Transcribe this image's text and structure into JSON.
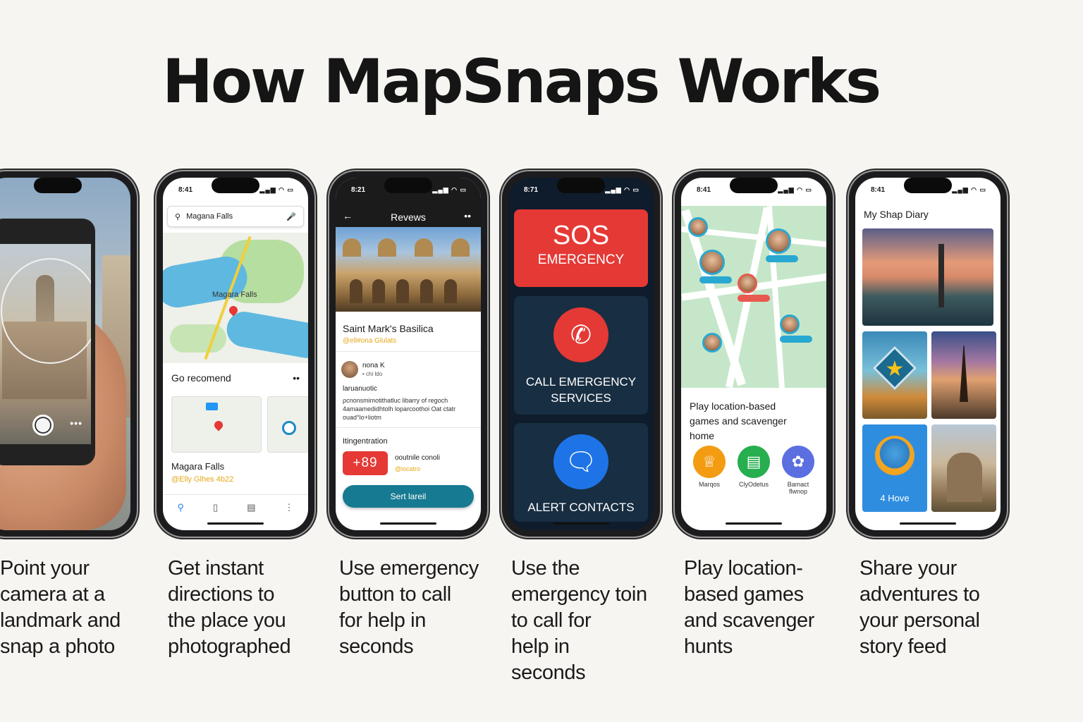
{
  "title": "How MapSnaps Works",
  "phones": {
    "p1": {
      "more": "•••"
    },
    "p2": {
      "time": "8:41",
      "signal": "▂▄▆ ◠ ▭",
      "search_value": "Magana Falls",
      "map_label": "Magara Falls",
      "section_title": "Go recomend",
      "section_more": "••",
      "place_name": "Magara Falls",
      "place_sub": "@Elly Glhes 4b22"
    },
    "p3": {
      "time": "8:21",
      "signal": "▂▄▆ ◠ ▭",
      "header_title": "Revews",
      "back": "←",
      "menu": "••",
      "place_name": "Saint Mark's Basilica",
      "place_sub": "@ell#ona Glulats",
      "user_name": "nona K",
      "user_time": "• chi ldo",
      "review_title": "laruanuotic",
      "review_body": "ρcnonsmimotithatluc libarry of regoch 4amaamedidhtolh loparcoothoi Oat ctatr ouad°lo+liotm",
      "section2": "Itingentration",
      "number": "+89",
      "contact_name": "ooutnile conoli",
      "contact_sub": "@locatro",
      "button_label": "Sert lareil"
    },
    "p4": {
      "time": "8:71",
      "signal": "▂▄▆ ◠ ▭",
      "sos_big": "SOS",
      "sos_small": "EMERGENCY",
      "call_label_1": "CALL EMERGENCY",
      "call_label_2": "SERVICES",
      "alert_label": "ALERT CONTACTS"
    },
    "p5": {
      "time": "8:41",
      "signal": "▂▄▆ ◠ ▭",
      "desc_1": "Play location-based",
      "desc_2": "games and scavenger",
      "desc_3": "home",
      "games": [
        {
          "label": "Marqos"
        },
        {
          "label": "ClyOdetus"
        },
        {
          "label": "Bamact flwnop"
        }
      ]
    },
    "p6": {
      "time": "8:41",
      "signal": "▂▄▆ ◠ ▭",
      "header": "My Shap Diary",
      "tile_label": "4 Hove"
    }
  },
  "captions": [
    [
      "Point your",
      "camera at a",
      "landmark and",
      "snap a photo"
    ],
    [
      "Get instant",
      "directions to",
      "the place you",
      "photographed"
    ],
    [
      "Use emergency",
      "button to call",
      "for help in",
      "seconds"
    ],
    [
      "Use the",
      "emergency toin",
      "to call for",
      "help in",
      "seconds"
    ],
    [
      "Play location-",
      "based games",
      "and scavenger",
      "hunts"
    ],
    [
      "Share your",
      "adventures to",
      "your personal",
      "story feed"
    ]
  ]
}
